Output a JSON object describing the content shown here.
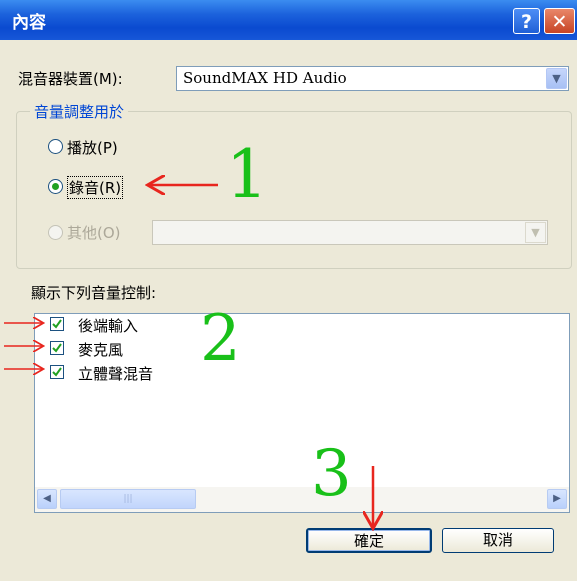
{
  "window": {
    "title": "內容",
    "help_button": "?",
    "close_button": "✕"
  },
  "mixer": {
    "label": "混音器裝置(M):",
    "value": "SoundMAX HD Audio"
  },
  "volume_group": {
    "title": "音量調整用於",
    "options": [
      {
        "label": "播放(P)",
        "selected": false,
        "enabled": true
      },
      {
        "label": "錄音(R)",
        "selected": true,
        "enabled": true
      },
      {
        "label": "其他(O)",
        "selected": false,
        "enabled": false
      }
    ]
  },
  "controls": {
    "label": "顯示下列音量控制:",
    "items": [
      {
        "label": "後端輸入",
        "checked": true
      },
      {
        "label": "麥克風",
        "checked": true
      },
      {
        "label": "立體聲混音",
        "checked": true
      }
    ]
  },
  "buttons": {
    "ok": "確定",
    "cancel": "取消"
  },
  "annotations": {
    "step1": "1",
    "step2": "2",
    "step3": "3",
    "arrow_color": "#e8261e",
    "number_color": "#19c019"
  }
}
